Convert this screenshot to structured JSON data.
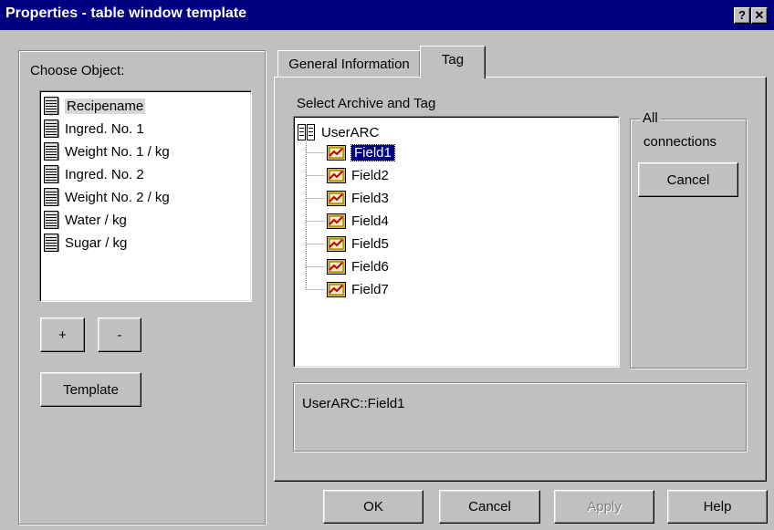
{
  "window": {
    "title": "Properties - table window template",
    "help_button": "?",
    "close_button": "✕"
  },
  "left_panel": {
    "choose_label": "Choose Object:",
    "objects": [
      {
        "label": "Recipename",
        "selected": true
      },
      {
        "label": "Ingred. No. 1"
      },
      {
        "label": "Weight No. 1 / kg"
      },
      {
        "label": "Ingred. No. 2"
      },
      {
        "label": "Weight No. 2 / kg"
      },
      {
        "label": "Water / kg"
      },
      {
        "label": "Sugar / kg"
      }
    ],
    "plus_label": "+",
    "minus_label": "-",
    "template_label": "Template"
  },
  "tabs": [
    {
      "label": "General Information",
      "active": false
    },
    {
      "label": "Tag",
      "active": true
    }
  ],
  "tag_panel": {
    "select_label": "Select Archive and Tag",
    "archive": "UserARC",
    "fields": [
      "Field1",
      "Field2",
      "Field3",
      "Field4",
      "Field5",
      "Field6",
      "Field7"
    ],
    "selected_field": "Field1",
    "all_connections_group": "All",
    "all_connections_label": "connections",
    "cancel_label": "Cancel",
    "selection_display": "UserARC::Field1"
  },
  "footer": {
    "ok_label": "OK",
    "cancel_label": "Cancel",
    "apply_label": "Apply",
    "apply_enabled": false,
    "help_label": "Help"
  },
  "icons": {
    "list_item": "table-column-icon",
    "archive": "archive-icon",
    "field": "tag-field-icon"
  },
  "colors": {
    "titlebar": "#000080",
    "face": "#c0c0c0",
    "selection": "#000080"
  }
}
